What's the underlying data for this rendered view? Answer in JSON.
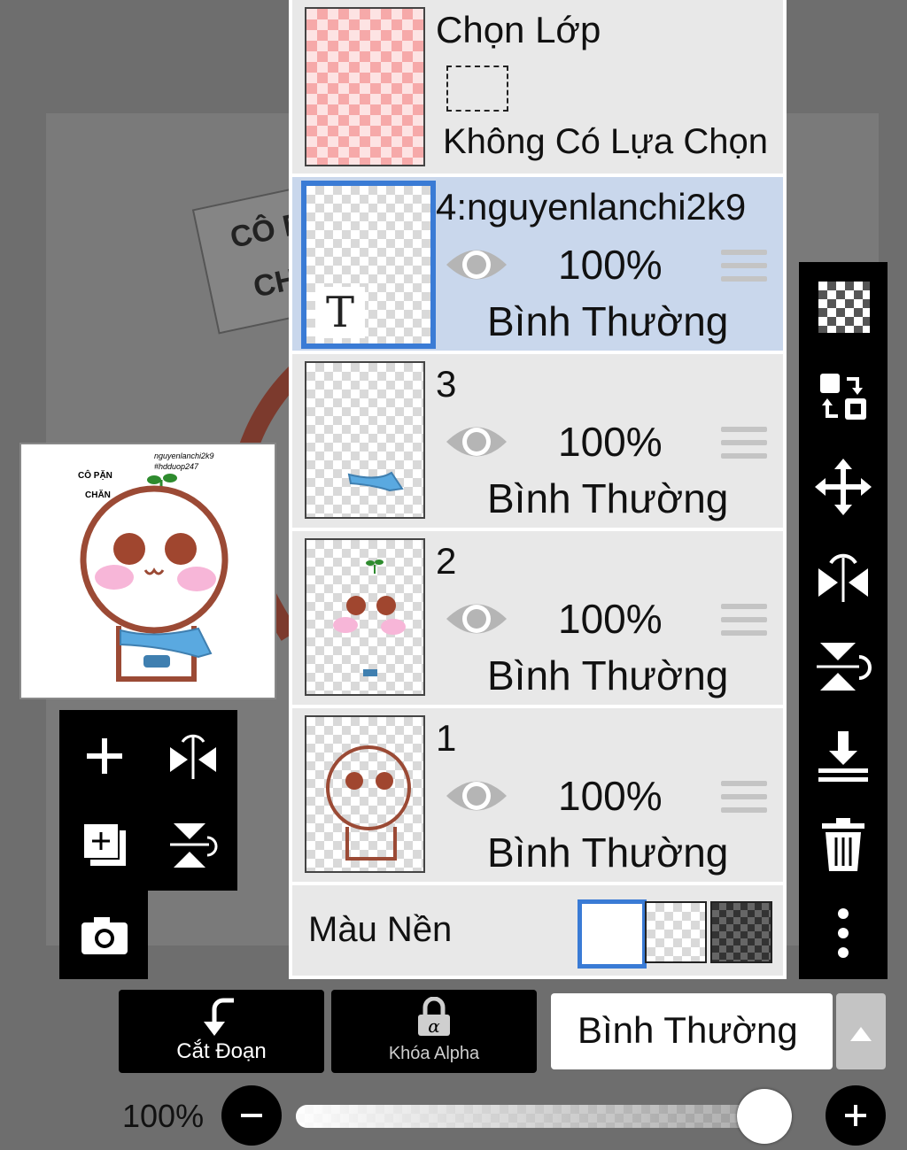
{
  "layer_panel": {
    "selection_layer": {
      "title": "Chọn Lớp",
      "status": "Không Có Lựa Chọn"
    },
    "layers": [
      {
        "name": "4:nguyenlanchi2k9",
        "opacity": "100%",
        "blend": "Bình Thường",
        "selected": true,
        "text_badge": "T"
      },
      {
        "name": "3",
        "opacity": "100%",
        "blend": "Bình Thường",
        "selected": false
      },
      {
        "name": "2",
        "opacity": "100%",
        "blend": "Bình Thường",
        "selected": false
      },
      {
        "name": "1",
        "opacity": "100%",
        "blend": "Bình Thường",
        "selected": false
      }
    ],
    "background_label": "Màu Nền"
  },
  "preview": {
    "text_left_1": "CÔ PẶN",
    "text_left_2": "CHĂN",
    "text_right_1": "nguyenlanchi2k9",
    "text_right_2": "#hdduop247"
  },
  "canvas_sticker": {
    "line1": "CÔ P",
    "line2": "CH"
  },
  "bottom_bar": {
    "clip_label": "Cắt Đoạn",
    "alpha_lock_label": "Khóa Alpha",
    "blend_mode": "Bình Thường",
    "opacity_label": "100%",
    "opacity_value": 1.0
  },
  "right_toolbar": {
    "icons": [
      "transparency-icon",
      "swap-layer-icon",
      "move-icon",
      "flip-horizontal-icon",
      "flip-vertical-icon",
      "merge-down-icon",
      "trash-icon",
      "more-icon"
    ]
  },
  "left_toolbar": {
    "icons": [
      "add-layer-icon",
      "flip-horizontal-icon",
      "duplicate-layer-icon",
      "flip-vertical-icon",
      "camera-icon"
    ]
  },
  "colors": {
    "selected_blue": "#3a7bd5",
    "selected_row": "#c9d7ec",
    "brown": "#9b4a35",
    "scarf": "#5aa9e0"
  }
}
